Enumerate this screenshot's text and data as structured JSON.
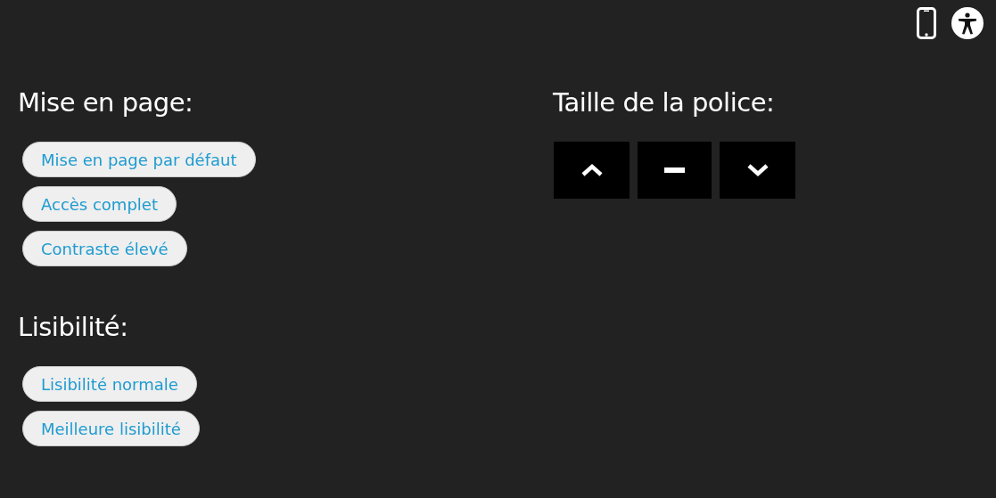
{
  "layout": {
    "title": "Mise en page:",
    "options": [
      {
        "label": "Mise en page par défaut"
      },
      {
        "label": "Accès complet"
      },
      {
        "label": "Contraste élevé"
      }
    ]
  },
  "readability": {
    "title": "Lisibilité:",
    "options": [
      {
        "label": "Lisibilité normale"
      },
      {
        "label": "Meilleure lisibilité"
      }
    ]
  },
  "font_size": {
    "title": "Taille de la police:",
    "buttons": [
      {
        "kind": "increase"
      },
      {
        "kind": "reset"
      },
      {
        "kind": "decrease"
      }
    ]
  }
}
